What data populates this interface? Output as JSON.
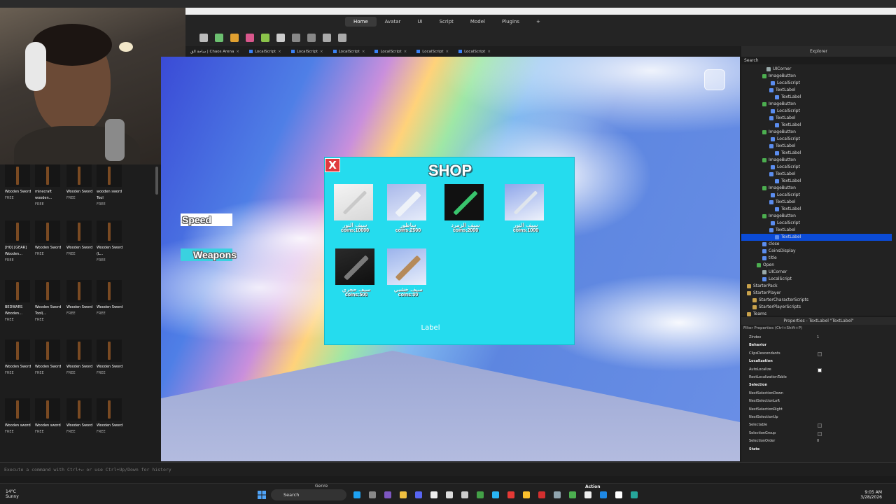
{
  "ribbon": {
    "tabs": [
      "Home",
      "Avatar",
      "UI",
      "Script",
      "Model",
      "Plugins"
    ],
    "active_tab": "Home"
  },
  "doc_tabs": [
    "ساحة الق | Chaos Arena",
    "LocalScript",
    "LocalScript",
    "LocalScript",
    "LocalScript",
    "LocalScript",
    "LocalScript"
  ],
  "game_ui": {
    "speed_label": "Speed",
    "weapons_label": "Weapons",
    "shop": {
      "title": "SHOP",
      "close_label": "X",
      "label_text": "Label",
      "items": [
        {
          "name": "سيف النور",
          "price": "coins:10000",
          "color": "#c9c9c9"
        },
        {
          "name": "ساطور",
          "price": "coins:2500",
          "color": "#dfe6ee"
        },
        {
          "name": "سيف الزمرد",
          "price": "coins:2000",
          "color": "#39c46d"
        },
        {
          "name": "سيف النور",
          "price": "coins:1000",
          "color": "#cfd6de"
        },
        {
          "name": "سيف حجري",
          "price": "coins:500",
          "color": "#6b6b6b"
        },
        {
          "name": "سيف خشبي",
          "price": "coins:00",
          "color": "#b58a5a"
        }
      ]
    }
  },
  "toolbox": {
    "items": [
      {
        "name": "Wooden Sword",
        "price": "FREE"
      },
      {
        "name": "minecraft wooden...",
        "price": "FREE"
      },
      {
        "name": "Wooden Sword",
        "price": "FREE"
      },
      {
        "name": "wooden sword Tool",
        "price": "FREE"
      },
      {
        "name": "[HQ] [GEAR] Wooden...",
        "price": "FREE"
      },
      {
        "name": "Wooden Sword",
        "price": "FREE"
      },
      {
        "name": "Wooden Sword",
        "price": "FREE"
      },
      {
        "name": "Wooden Sword (L...",
        "price": "FREE"
      },
      {
        "name": "BEDWARS Wooden...",
        "price": "FREE"
      },
      {
        "name": "Wooden Sword Tool(...",
        "price": "FREE"
      },
      {
        "name": "Wooden Sword",
        "price": "FREE"
      },
      {
        "name": "Wooden Sword",
        "price": "FREE"
      },
      {
        "name": "Wooden Sword",
        "price": "FREE"
      },
      {
        "name": "Wooden Sword",
        "price": "FREE"
      },
      {
        "name": "Wooden Sword",
        "price": "FREE"
      },
      {
        "name": "Wooden Sword",
        "price": "FREE"
      },
      {
        "name": "Wooden sword",
        "price": "FREE"
      },
      {
        "name": "Wooden sword",
        "price": "FREE"
      },
      {
        "name": "Wooden Sword",
        "price": "FREE"
      },
      {
        "name": "Wooden Sword",
        "price": "FREE"
      }
    ]
  },
  "explorer": {
    "title": "Explorer",
    "search_placeholder": "Search",
    "rows": [
      {
        "label": "UICorner",
        "indent": 36,
        "icon": "#9aa"
      },
      {
        "label": "ImageButton",
        "indent": 30,
        "icon": "#4caf50"
      },
      {
        "label": "LocalScript",
        "indent": 42,
        "icon": "#5b8def"
      },
      {
        "label": "TextLabel",
        "indent": 40,
        "icon": "#5b8def"
      },
      {
        "label": "TextLabel",
        "indent": 48,
        "icon": "#5b8def"
      },
      {
        "label": "ImageButton",
        "indent": 30,
        "icon": "#4caf50"
      },
      {
        "label": "LocalScript",
        "indent": 42,
        "icon": "#5b8def"
      },
      {
        "label": "TextLabel",
        "indent": 40,
        "icon": "#5b8def"
      },
      {
        "label": "TextLabel",
        "indent": 48,
        "icon": "#5b8def"
      },
      {
        "label": "ImageButton",
        "indent": 30,
        "icon": "#4caf50"
      },
      {
        "label": "LocalScript",
        "indent": 42,
        "icon": "#5b8def"
      },
      {
        "label": "TextLabel",
        "indent": 40,
        "icon": "#5b8def"
      },
      {
        "label": "TextLabel",
        "indent": 48,
        "icon": "#5b8def"
      },
      {
        "label": "ImageButton",
        "indent": 30,
        "icon": "#4caf50"
      },
      {
        "label": "LocalScript",
        "indent": 42,
        "icon": "#5b8def"
      },
      {
        "label": "TextLabel",
        "indent": 40,
        "icon": "#5b8def"
      },
      {
        "label": "TextLabel",
        "indent": 48,
        "icon": "#5b8def"
      },
      {
        "label": "ImageButton",
        "indent": 30,
        "icon": "#4caf50"
      },
      {
        "label": "LocalScript",
        "indent": 42,
        "icon": "#5b8def"
      },
      {
        "label": "TextLabel",
        "indent": 40,
        "icon": "#5b8def"
      },
      {
        "label": "TextLabel",
        "indent": 48,
        "icon": "#5b8def"
      },
      {
        "label": "ImageButton",
        "indent": 30,
        "icon": "#4caf50"
      },
      {
        "label": "LocalScript",
        "indent": 42,
        "icon": "#5b8def"
      },
      {
        "label": "TextLabel",
        "indent": 40,
        "icon": "#5b8def"
      },
      {
        "label": "TextLabel",
        "indent": 48,
        "icon": "#5b8def",
        "selected": true
      },
      {
        "label": "close",
        "indent": 30,
        "icon": "#5b8def"
      },
      {
        "label": "CoinsDisplay",
        "indent": 30,
        "icon": "#5b8def"
      },
      {
        "label": "title",
        "indent": 30,
        "icon": "#5b8def"
      },
      {
        "label": "Open",
        "indent": 22,
        "icon": "#4caf50"
      },
      {
        "label": "UICorner",
        "indent": 30,
        "icon": "#9aa"
      },
      {
        "label": "LocalScript",
        "indent": 30,
        "icon": "#5b8def"
      },
      {
        "label": "StarterPack",
        "indent": 8,
        "icon": "#c9a24b"
      },
      {
        "label": "StarterPlayer",
        "indent": 8,
        "icon": "#c9a24b"
      },
      {
        "label": "StarterCharacterScripts",
        "indent": 16,
        "icon": "#c9a24b"
      },
      {
        "label": "StarterPlayerScripts",
        "indent": 16,
        "icon": "#c9a24b"
      },
      {
        "label": "Teams",
        "indent": 8,
        "icon": "#c9a24b"
      }
    ]
  },
  "properties": {
    "title": "Properties - TextLabel \"TextLabel\"",
    "filter_placeholder": "Filter Properties (Ctrl+Shift+P)",
    "rows": [
      {
        "key": "ZIndex",
        "value": "1",
        "type": "text"
      },
      {
        "key": "Behavior",
        "section": true
      },
      {
        "key": "ClipsDescendants",
        "type": "check",
        "checked": false
      },
      {
        "key": "Localization",
        "section": true
      },
      {
        "key": "AutoLocalize",
        "type": "check",
        "checked": true
      },
      {
        "key": "RootLocalizationTable",
        "type": "text",
        "value": ""
      },
      {
        "key": "Selection",
        "section": true
      },
      {
        "key": "NextSelectionDown",
        "type": "text",
        "value": ""
      },
      {
        "key": "NextSelectionLeft",
        "type": "text",
        "value": ""
      },
      {
        "key": "NextSelectionRight",
        "type": "text",
        "value": ""
      },
      {
        "key": "NextSelectionUp",
        "type": "text",
        "value": ""
      },
      {
        "key": "Selectable",
        "type": "check",
        "checked": false
      },
      {
        "key": "SelectionGroup",
        "type": "check",
        "checked": false
      },
      {
        "key": "SelectionOrder",
        "value": "0",
        "type": "text"
      },
      {
        "key": "State",
        "section": true
      }
    ]
  },
  "command_bar": {
    "placeholder": "Execute a command with Ctrl+↵ or use Ctrl+Up/Down for history"
  },
  "taskbar": {
    "temperature": "14°C",
    "weather": "Sunny",
    "search_label": "Search",
    "time": "9:05 AM",
    "date": "3/28/2026",
    "genre_label": "Genre",
    "action_label": "Action"
  }
}
